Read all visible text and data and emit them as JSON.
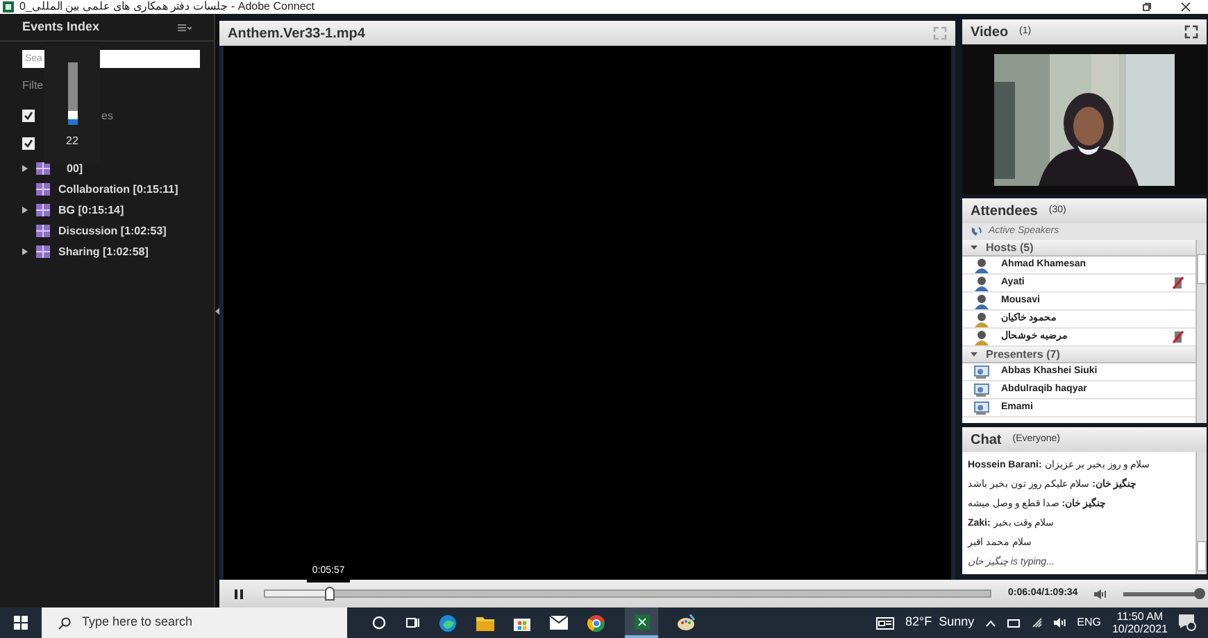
{
  "window": {
    "title": "جلسات دفتر همکاری های علمی بین المللی_0 - Adobe Connect"
  },
  "events_index": {
    "title": "Events Index",
    "search": {
      "placeholder": "Sea"
    },
    "filter_label": "Filte",
    "checkboxes": [
      {
        "tail": "es",
        "checked": true
      },
      {
        "checked": true
      }
    ],
    "volume_popup": {
      "level": 0.22,
      "reading": "22"
    },
    "items": [
      {
        "label": "00]",
        "expandable": true
      },
      {
        "label": "Collaboration [0:15:11]",
        "expandable": false
      },
      {
        "label": "BG [0:15:14]",
        "expandable": true
      },
      {
        "label": "Discussion [1:02:53]",
        "expandable": false
      },
      {
        "label": "Sharing [1:02:58]",
        "expandable": true
      }
    ]
  },
  "share_pod": {
    "title": "Anthem.Ver33-1.mp4"
  },
  "video_pod": {
    "title": "Video",
    "count": "(1)"
  },
  "attendees": {
    "title": "Attendees",
    "count": "(30)",
    "active_speakers": "Active Speakers",
    "groups": [
      {
        "label": "Hosts (5)",
        "expanded": true,
        "people": [
          {
            "name": "Ahmad Khamesan",
            "kind": "host",
            "muted_mic": false
          },
          {
            "name": "Ayati",
            "kind": "host",
            "muted_mic": true
          },
          {
            "name": "Mousavi",
            "kind": "host",
            "muted_mic": false
          },
          {
            "name": "محمود خاکیان",
            "kind": "guest",
            "muted_mic": false
          },
          {
            "name": "مرضیه خوشحال",
            "kind": "guest",
            "muted_mic": true
          }
        ]
      },
      {
        "label": "Presenters (7)",
        "expanded": true,
        "people": [
          {
            "name": "Abbas Khashei Siuki",
            "kind": "presenter",
            "muted_mic": false
          },
          {
            "name": "Abdulraqib haqyar",
            "kind": "presenter",
            "muted_mic": false
          },
          {
            "name": "Emami",
            "kind": "presenter",
            "muted_mic": false
          }
        ]
      }
    ]
  },
  "chat": {
    "title": "Chat",
    "audience": "(Everyone)",
    "messages": [
      {
        "text": "**Hossein Barani:** سلام و روز بخیر بر عزیزان"
      },
      {
        "text": "**چنگیز خان:** سلام علیکم روز تون بخیر باشد"
      },
      {
        "text": "**چنگیز خان:** صدا قطع و وصل میشه"
      },
      {
        "text": "**Zaki:** سلام وقت بخیر"
      },
      {
        "text": "سلام محمد اقبر"
      }
    ],
    "typing": "چنگیز خان is typing..."
  },
  "player": {
    "playing": true,
    "level": 0.088,
    "tooltip": "0:05:57",
    "time": "0:06:04/1:09:34",
    "volume": {
      "level": 1
    }
  },
  "taskbar": {
    "search_placeholder": "Type here to search",
    "weather": "82°F  Sunny",
    "language": "ENG",
    "time": "11:50 AM",
    "date": "10/20/2021"
  }
}
